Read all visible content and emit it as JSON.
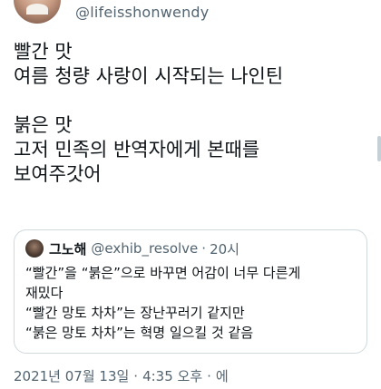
{
  "tweet": {
    "handle": "@lifeisshonwendy",
    "text_lines": [
      "빨간 맛",
      "여름 청량 사랑이 시작되는 나인틴",
      "",
      "붉은 맛",
      "고저 민족의 반역자에게 본때를",
      "보여주갓어"
    ],
    "date": "2021년 07월 13일",
    "time": "4:35 오후",
    "meta_trailing": "에",
    "separator": "·"
  },
  "quote": {
    "name": "그노해",
    "handle": "@exhib_resolve",
    "separator": "·",
    "time": "20시",
    "lines": [
      "“빨간”을 “붉은”으로 바꾸면 어감이 너무 다른게",
      "재밌다",
      "“빨간 망토 차차”는 장난꾸러기 같지만",
      "“붉은 망토 차차”는 혁명 일으킬 것 같음"
    ]
  },
  "colors": {
    "text": "#0f1419",
    "secondary": "#536471",
    "border": "#cfd9de"
  }
}
